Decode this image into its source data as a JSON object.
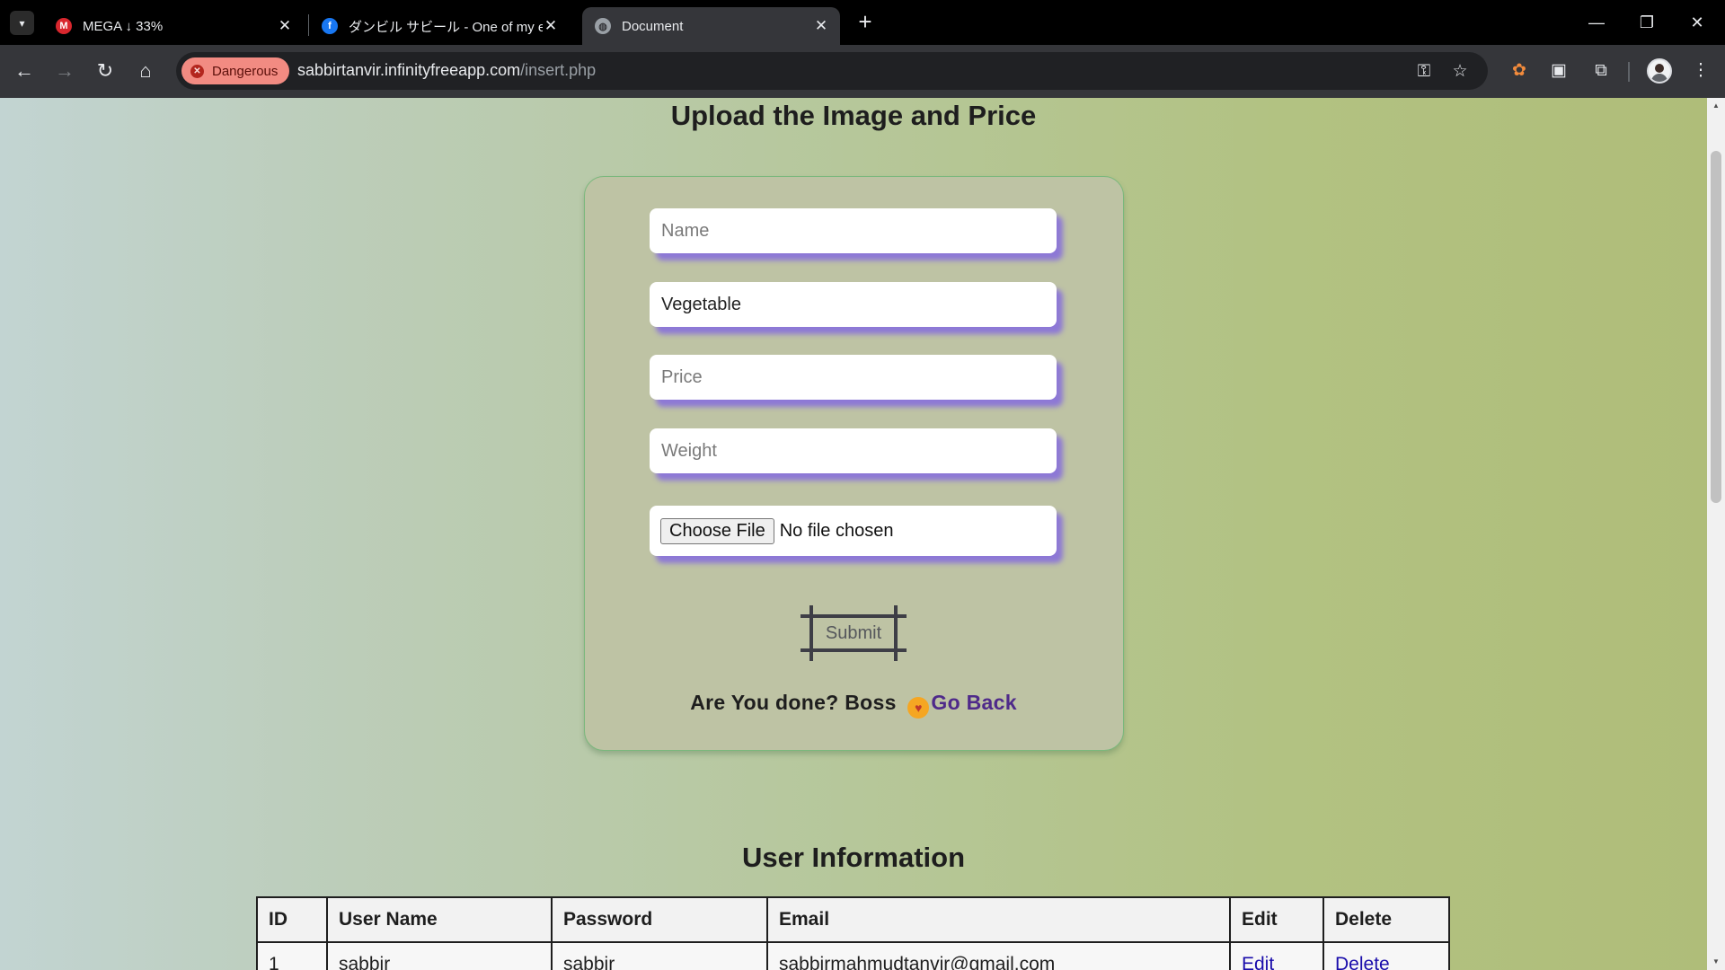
{
  "browser": {
    "tabs": [
      {
        "title": "MEGA ↓ 33%",
        "favicon": "mega-icon",
        "active": false
      },
      {
        "title": "ダンビル サビール - One of my eCo",
        "favicon": "facebook-icon",
        "active": false
      },
      {
        "title": "Document",
        "favicon": "globe-icon",
        "active": true
      }
    ],
    "security_badge": "Dangerous",
    "url_host": "sabbirtanvir.infinityfreeapp.com",
    "url_path": "/insert.php",
    "colors": {
      "danger_badge": "#f28b82",
      "tab_strip": "#000000",
      "toolbar": "#35363a"
    }
  },
  "page": {
    "title": "Upload the Image and Price",
    "form": {
      "name_placeholder": "Name",
      "category_value": "Vegetable",
      "price_placeholder": "Price",
      "weight_placeholder": "Weight",
      "file_button": "Choose File",
      "file_status": "No file chosen",
      "submit_label": "Submit",
      "done_text": "Are You done? Boss",
      "go_back_label": "Go Back"
    },
    "users_section_title": "User Information",
    "users_table": {
      "columns": [
        "ID",
        "User Name",
        "Password",
        "Email",
        "Edit",
        "Delete"
      ],
      "rows": [
        {
          "id": "1",
          "username": "sabbir",
          "password": "sabbir",
          "email": "sabbirmahmudtanvir@gmail.com",
          "edit": "Edit",
          "delete": "Delete"
        }
      ]
    },
    "colors": {
      "field_shadow": "#8d78d6",
      "link": "#4f2a8a",
      "card_border": "#7ab87c"
    }
  }
}
